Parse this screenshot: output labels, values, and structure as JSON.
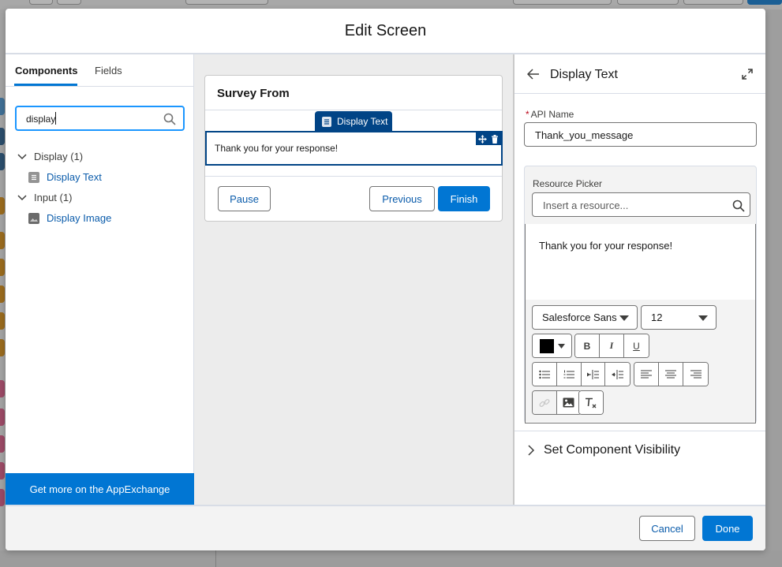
{
  "modal": {
    "title": "Edit Screen"
  },
  "left_panel": {
    "tabs": [
      {
        "label": "Components",
        "active": true
      },
      {
        "label": "Fields",
        "active": false
      }
    ],
    "search": {
      "value": "display"
    },
    "tree": [
      {
        "label": "Display (1)",
        "items": [
          {
            "label": "Display Text",
            "icon": "display-text-icon"
          }
        ]
      },
      {
        "label": "Input (1)",
        "items": [
          {
            "label": "Display Image",
            "icon": "image-icon"
          }
        ]
      }
    ],
    "appexchange_label": "Get more on the AppExchange"
  },
  "canvas": {
    "screen_title": "Survey From",
    "selected_component_tag": "Display Text",
    "selected_component_text": "Thank you for your response!",
    "buttons": {
      "pause": "Pause",
      "previous": "Previous",
      "finish": "Finish"
    }
  },
  "properties": {
    "title": "Display Text",
    "api_name": {
      "label": "API Name",
      "required_marker": "*",
      "value": "Thank_you_message"
    },
    "resource_picker": {
      "label": "Resource Picker",
      "placeholder": "Insert a resource..."
    },
    "editor_text": "Thank you for your response!",
    "font_family": "Salesforce Sans",
    "font_size": "12",
    "text_color": "#000000",
    "format_buttons": {
      "bold": "B",
      "italic": "I",
      "underline": "U"
    },
    "set_visibility_label": "Set Component Visibility"
  },
  "footer": {
    "cancel": "Cancel",
    "done": "Done"
  },
  "colors": {
    "brand": "#0176d3",
    "selected_component": "#014486",
    "required": "#ba0517"
  }
}
